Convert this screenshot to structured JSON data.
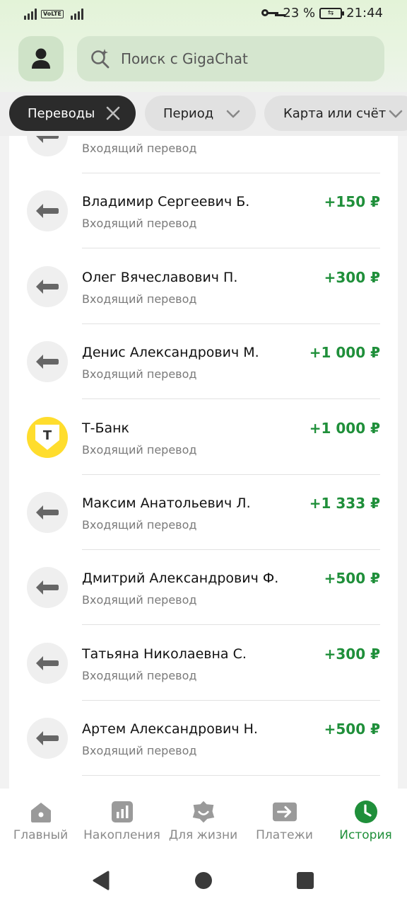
{
  "status_bar": {
    "battery_percent": "23 %",
    "time": "21:44",
    "volte": "VoLTE"
  },
  "header": {
    "search_placeholder": "Поиск с GigaChat"
  },
  "filters": {
    "active_chip": "Переводы",
    "period": "Период",
    "card": "Карта или счёт"
  },
  "transactions": [
    {
      "name": "",
      "subtitle": "Входящий перевод",
      "amount": "",
      "icon": "arrow-left-icon"
    },
    {
      "name": "Владимир Сергеевич Б.",
      "subtitle": "Входящий перевод",
      "amount": "+150 ₽",
      "icon": "arrow-left-icon"
    },
    {
      "name": "Олег Вячеславович П.",
      "subtitle": "Входящий перевод",
      "amount": "+300 ₽",
      "icon": "arrow-left-icon"
    },
    {
      "name": "Денис Александрович М.",
      "subtitle": "Входящий перевод",
      "amount": "+1 000 ₽",
      "icon": "arrow-left-icon"
    },
    {
      "name": "Т-Банк",
      "subtitle": "Входящий перевод",
      "amount": "+1 000 ₽",
      "icon": "tbank-logo"
    },
    {
      "name": "Максим Анатольевич Л.",
      "subtitle": "Входящий перевод",
      "amount": "+1 333 ₽",
      "icon": "arrow-left-icon"
    },
    {
      "name": "Дмитрий Александрович Ф.",
      "subtitle": "Входящий перевод",
      "amount": "+500 ₽",
      "icon": "arrow-left-icon"
    },
    {
      "name": "Татьяна Николаевна С.",
      "subtitle": "Входящий перевод",
      "amount": "+300 ₽",
      "icon": "arrow-left-icon"
    },
    {
      "name": "Артем Александрович Н.",
      "subtitle": "Входящий перевод",
      "amount": "+500 ₽",
      "icon": "arrow-left-icon"
    }
  ],
  "tbank_letter": "Т",
  "bottom_nav": [
    {
      "label": "Главный",
      "icon": "home-icon"
    },
    {
      "label": "Накопления",
      "icon": "chart-icon"
    },
    {
      "label": "Для жизни",
      "icon": "smile-icon"
    },
    {
      "label": "Платежи",
      "icon": "transfer-icon"
    },
    {
      "label": "История",
      "icon": "clock-icon",
      "active": true
    }
  ],
  "colors": {
    "accent_green": "#1f8f3a",
    "amount_green": "#1f8f3a",
    "chip_dark": "#2b2b2b",
    "tbank_yellow": "#ffdd2d"
  }
}
